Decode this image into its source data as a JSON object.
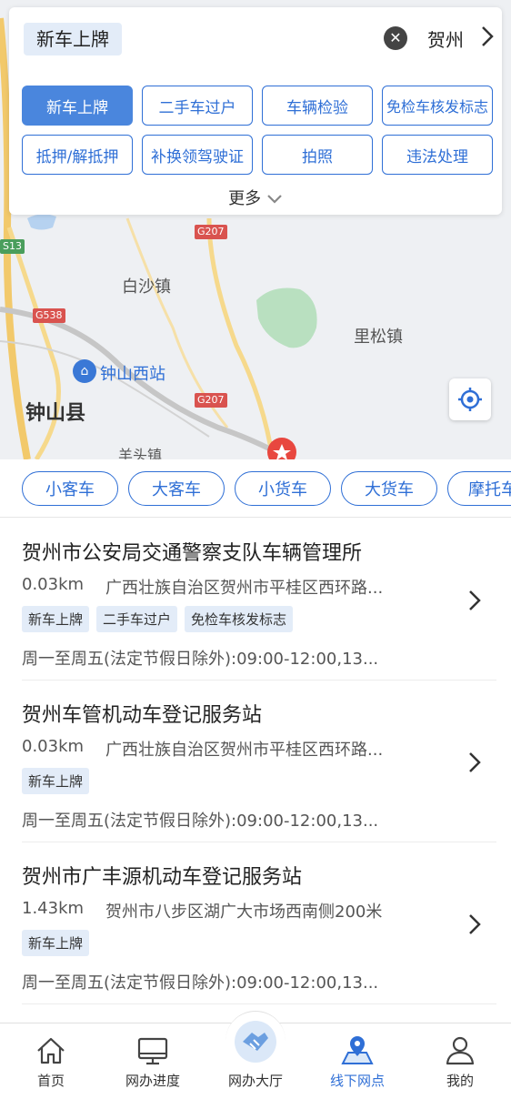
{
  "map": {
    "labels": {
      "baisha": "白沙镇",
      "lisong": "里松镇",
      "zhongshan_west": "钟山西站",
      "zhongshan_county": "钟山县",
      "yangtou": "羊头镇"
    },
    "roads": {
      "g207_top": "G207",
      "g207_bottom": "G207",
      "g538": "G538",
      "s13": "S13"
    }
  },
  "panel": {
    "current_service": "新车上牌",
    "city": "贺州",
    "services": [
      {
        "label": "新车上牌",
        "active": true
      },
      {
        "label": "二手车过户"
      },
      {
        "label": "车辆检验"
      },
      {
        "label": "免检车核发标志"
      },
      {
        "label": "抵押/解抵押"
      },
      {
        "label": "补换领驾驶证"
      },
      {
        "label": "拍照"
      },
      {
        "label": "违法处理"
      }
    ],
    "more_label": "更多"
  },
  "chips": [
    "小客车",
    "大客车",
    "小货车",
    "大货车",
    "摩托车"
  ],
  "list": [
    {
      "name": "贺州市公安局交通警察支队车辆管理所",
      "distance": "0.03km",
      "address": "广西壮族自治区贺州市平桂区西环路...",
      "tags": [
        "新车上牌",
        "二手车过户",
        "免检车核发标志"
      ],
      "hours": "周一至周五(法定节假日除外):09:00-12:00,13..."
    },
    {
      "name": "贺州车管机动车登记服务站",
      "distance": "0.03km",
      "address": "广西壮族自治区贺州市平桂区西环路...",
      "tags": [
        "新车上牌"
      ],
      "hours": "周一至周五(法定节假日除外):09:00-12:00,13..."
    },
    {
      "name": "贺州市广丰源机动车登记服务站",
      "distance": "1.43km",
      "address": "贺州市八步区湖广大市场西南侧200米",
      "tags": [
        "新车上牌"
      ],
      "hours": "周一至周五(法定节假日除外):09:00-12:00,13..."
    }
  ],
  "nav": [
    {
      "label": "首页",
      "icon": "home-icon"
    },
    {
      "label": "网办进度",
      "icon": "monitor-icon"
    },
    {
      "label": "网办大厅",
      "icon": "handshake-icon"
    },
    {
      "label": "线下网点",
      "icon": "map-pin-icon",
      "active": true
    },
    {
      "label": "我的",
      "icon": "user-icon"
    }
  ],
  "colors": {
    "accent": "#2f6fd6",
    "active_button": "#4a86dd",
    "tag_bg": "#e3ecf8",
    "marker_red": "#e8473f"
  }
}
